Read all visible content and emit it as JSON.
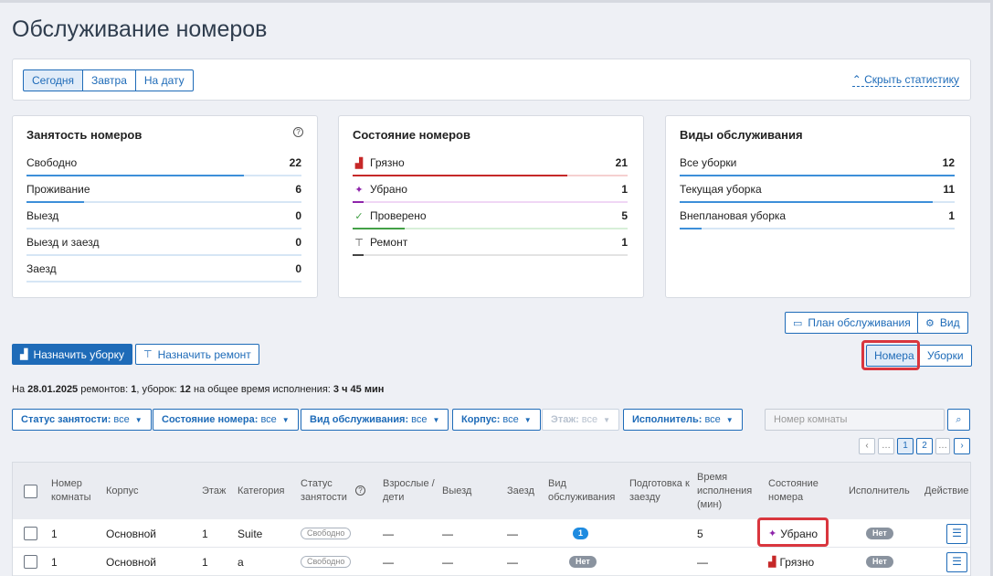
{
  "title": "Обслуживание номеров",
  "date_tabs": [
    "Сегодня",
    "Завтра",
    "На дату"
  ],
  "hide_stats": "Скрыть статистику",
  "colors": {
    "accent": "#1e6bb8",
    "dirty": "#c62828",
    "cleaned": "#8e24aa",
    "checked": "#43a047",
    "repair": "#444444",
    "highlight": "#d9363e"
  },
  "occupancy": {
    "title": "Занятость номеров",
    "help_icon": "?",
    "rows": [
      {
        "label": "Свободно",
        "value": "22",
        "fraction": 0.79
      },
      {
        "label": "Проживание",
        "value": "6",
        "fraction": 0.21
      },
      {
        "label": "Выезд",
        "value": "0",
        "fraction": 0
      },
      {
        "label": "Выезд и заезд",
        "value": "0",
        "fraction": 0
      },
      {
        "label": "Заезд",
        "value": "0",
        "fraction": 0
      }
    ]
  },
  "room_state": {
    "title": "Состояние номеров",
    "rows": [
      {
        "label": "Грязно",
        "value": "21",
        "fraction": 0.78,
        "icon": "dirty-icon",
        "glyph": "▟"
      },
      {
        "label": "Убрано",
        "value": "1",
        "fraction": 0.04,
        "icon": "cleaned-icon",
        "glyph": "✦"
      },
      {
        "label": "Проверено",
        "value": "5",
        "fraction": 0.19,
        "icon": "check-icon",
        "glyph": "✓"
      },
      {
        "label": "Ремонт",
        "value": "1",
        "fraction": 0.04,
        "icon": "roller-icon",
        "glyph": "⊤"
      }
    ]
  },
  "service_types": {
    "title": "Виды обслуживания",
    "rows": [
      {
        "label": "Все уборки",
        "value": "12",
        "fraction": 1
      },
      {
        "label": "Текущая уборка",
        "value": "11",
        "fraction": 0.92
      },
      {
        "label": "Внеплановая уборка",
        "value": "1",
        "fraction": 0.08
      }
    ]
  },
  "buttons": {
    "plan": "План обслуживания",
    "view": "Вид",
    "assign_cleaning": "Назначить уборку",
    "assign_repair": "Назначить ремонт",
    "rooms": "Номера",
    "cleanings": "Уборки"
  },
  "summary": {
    "p1": "На ",
    "date": "28.01.2025",
    "p2": " ремонтов: ",
    "repairs": "1",
    "p3": ", уборок: ",
    "cleanings": "12",
    "p4": " на общее время исполнения: ",
    "time": "3 ч 45 мин"
  },
  "filters": [
    {
      "label": "Статус занятости:",
      "value": "все"
    },
    {
      "label": "Состояние номера:",
      "value": "все"
    },
    {
      "label": "Вид обслуживания:",
      "value": "все"
    },
    {
      "label": "Корпус:",
      "value": "все"
    },
    {
      "label": "Этаж:",
      "value": "все"
    },
    {
      "label": "Исполнитель:",
      "value": "все"
    }
  ],
  "search": {
    "placeholder": "Номер комнаты"
  },
  "pagination": {
    "prev": "‹",
    "ellipsis": "…",
    "pages": [
      "1",
      "2"
    ],
    "next": "›"
  },
  "table": {
    "headers": [
      "Номер комнаты",
      "Корпус",
      "Этаж",
      "Категория",
      "Статус занятости",
      "Взрослые / дети",
      "Выезд",
      "Заезд",
      "Вид обслуживания",
      "Подготовка к заезду",
      "Время исполнения (мин)",
      "Состояние номера",
      "Исполнитель",
      "Действие"
    ],
    "rows": [
      {
        "room": "1",
        "building": "Основной",
        "floor": "1",
        "category": "Suite",
        "status": "Свободно",
        "adults": "—",
        "checkout": "—",
        "checkin": "—",
        "service": "1",
        "prep": "",
        "time": "5",
        "state": "Убрано",
        "executor": "Нет"
      },
      {
        "room": "1",
        "building": "Основной",
        "floor": "1",
        "category": "a",
        "status": "Свободно",
        "adults": "—",
        "checkout": "—",
        "checkin": "—",
        "service": "Нет",
        "prep": "",
        "time": "—",
        "state": "Грязно",
        "executor": "Нет"
      }
    ]
  }
}
